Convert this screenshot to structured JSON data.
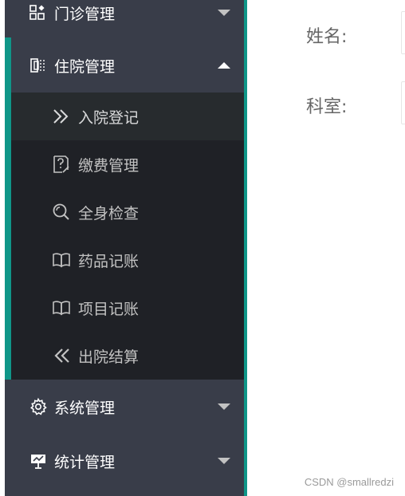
{
  "sidebar": {
    "groups": [
      {
        "label": "门诊管理",
        "icon": "apps-icon",
        "expanded": false
      },
      {
        "label": "住院管理",
        "icon": "book-shelf-icon",
        "expanded": true
      },
      {
        "label": "系统管理",
        "icon": "gear-icon",
        "expanded": false
      },
      {
        "label": "统计管理",
        "icon": "presentation-icon",
        "expanded": false
      }
    ],
    "submenu": [
      {
        "label": "入院登记",
        "icon": "double-chevron-right-icon",
        "active": true
      },
      {
        "label": "缴费管理",
        "icon": "help-doc-icon",
        "active": false
      },
      {
        "label": "全身检查",
        "icon": "search-icon",
        "active": false
      },
      {
        "label": "药品记账",
        "icon": "open-book-icon",
        "active": false
      },
      {
        "label": "项目记账",
        "icon": "open-book-icon",
        "active": false
      },
      {
        "label": "出院结算",
        "icon": "double-chevron-left-icon",
        "active": false
      }
    ]
  },
  "form": {
    "name_label": "姓名:",
    "dept_label": "科室:",
    "name_value": "",
    "dept_value": ""
  },
  "watermark": "CSDN @smallredzi",
  "colors": {
    "sidebar_bg": "#393d49",
    "submenu_bg": "#1f2126",
    "active_bg": "#272b2e",
    "accent": "#0f9688"
  }
}
